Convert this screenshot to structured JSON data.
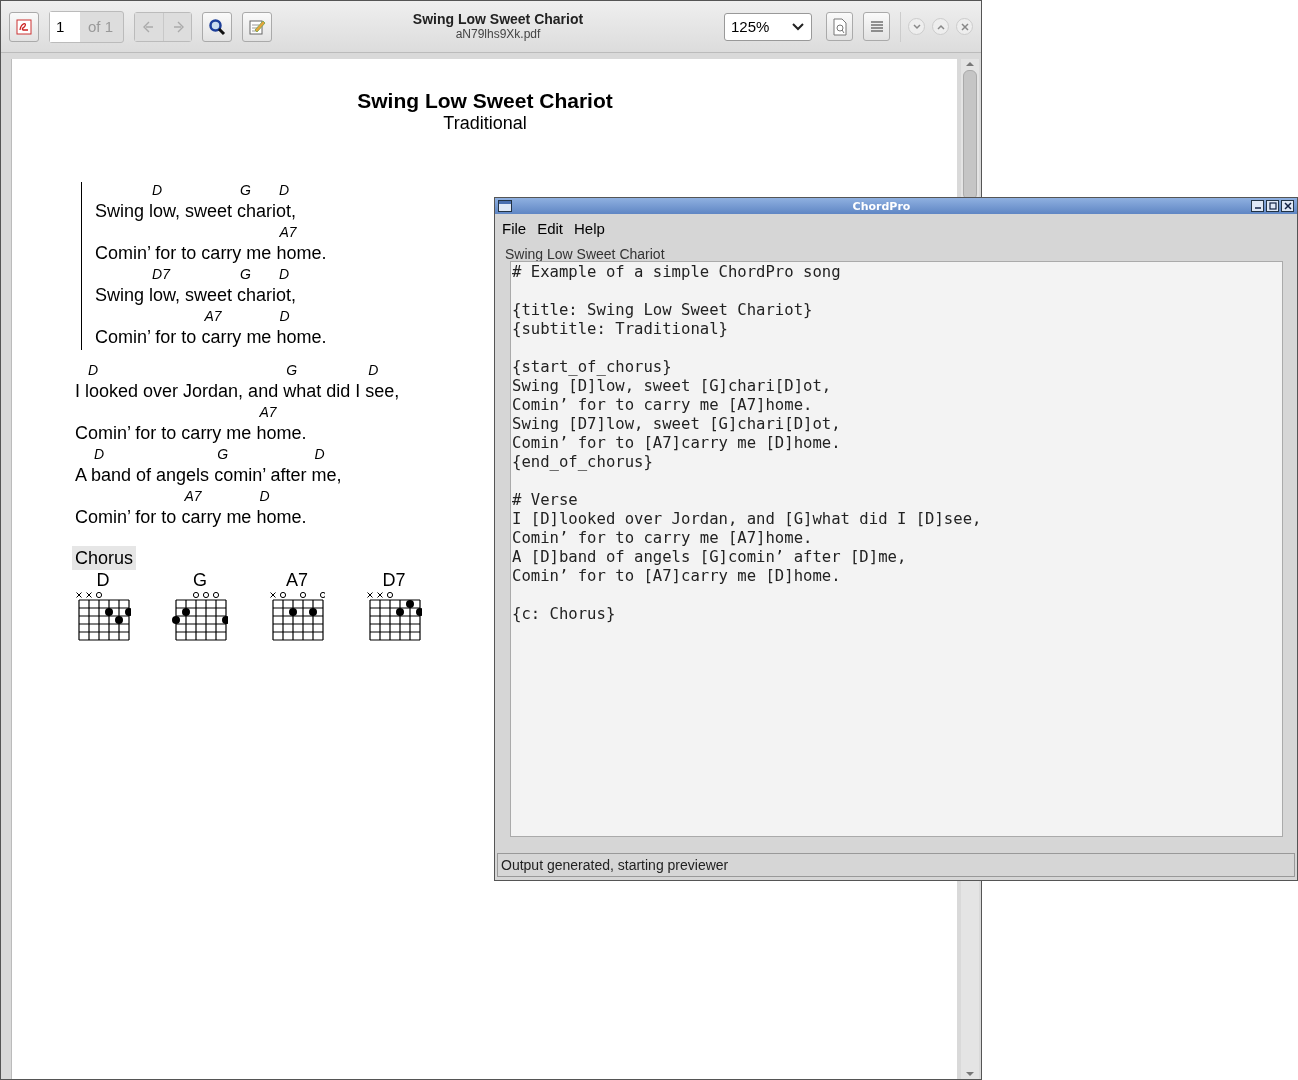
{
  "viewer": {
    "title": "Swing Low Sweet Chariot",
    "filename": "aN79lhs9Xk.pdf",
    "page": "1",
    "page_count": "of 1",
    "nav_disabled": true,
    "zoom": "125%"
  },
  "document": {
    "title": "Swing Low Sweet Chariot",
    "subtitle": "Traditional",
    "sections": [
      {
        "kind": "chorus",
        "lines": [
          [
            {
              "text": "Swing "
            },
            {
              "chord": "D",
              "text": "low, sweet "
            },
            {
              "chord": "G",
              "text": "chari"
            },
            {
              "chord": "D",
              "text": "ot,"
            }
          ],
          [
            {
              "text": "Comin’ for to carry me "
            },
            {
              "chord": "A7",
              "text": "home."
            }
          ],
          [
            {
              "text": "Swing "
            },
            {
              "chord": "D7",
              "text": "low, sweet "
            },
            {
              "chord": "G",
              "text": "chari"
            },
            {
              "chord": "D",
              "text": "ot,"
            }
          ],
          [
            {
              "text": "Comin’ for to "
            },
            {
              "chord": "A7",
              "text": "carry me "
            },
            {
              "chord": "D",
              "text": "home."
            }
          ]
        ]
      },
      {
        "kind": "verse",
        "lines": [
          [
            {
              "text": "I "
            },
            {
              "chord": "D",
              "text": "looked over Jordan, and "
            },
            {
              "chord": "G",
              "text": "what did I "
            },
            {
              "chord": "D",
              "text": "see,"
            }
          ],
          [
            {
              "text": "Comin’ for to carry me "
            },
            {
              "chord": "A7",
              "text": "home."
            }
          ],
          [
            {
              "text": "A "
            },
            {
              "chord": "D",
              "text": "band of angels "
            },
            {
              "chord": "G",
              "text": "comin’ after "
            },
            {
              "chord": "D",
              "text": "me,"
            }
          ],
          [
            {
              "text": "Comin’ for to "
            },
            {
              "chord": "A7",
              "text": "carry me "
            },
            {
              "chord": "D",
              "text": "home."
            }
          ]
        ]
      },
      {
        "kind": "comment",
        "text": "Chorus"
      }
    ],
    "chord_diagrams": [
      {
        "name": "D",
        "strings": [
          {
            "kind": "muted"
          },
          {
            "kind": "muted"
          },
          {
            "kind": "open"
          },
          {
            "kind": "fret2"
          },
          {
            "kind": "fret3"
          },
          {
            "kind": "fret2"
          }
        ]
      },
      {
        "name": "G",
        "strings": [
          {
            "kind": "fret3"
          },
          {
            "kind": "fret2"
          },
          {
            "kind": "open"
          },
          {
            "kind": "open"
          },
          {
            "kind": "open"
          },
          {
            "kind": "fret3"
          }
        ]
      },
      {
        "name": "A7",
        "strings": [
          {
            "kind": "muted"
          },
          {
            "kind": "open"
          },
          {
            "kind": "fret2"
          },
          {
            "kind": "open"
          },
          {
            "kind": "fret2"
          },
          {
            "kind": "open"
          }
        ]
      },
      {
        "name": "D7",
        "strings": [
          {
            "kind": "muted"
          },
          {
            "kind": "muted"
          },
          {
            "kind": "open"
          },
          {
            "kind": "fret2"
          },
          {
            "kind": "fret1"
          },
          {
            "kind": "fret2"
          }
        ]
      }
    ]
  },
  "editor": {
    "title": "ChordPro",
    "menu": [
      "File",
      "Edit",
      "Help"
    ],
    "label": "Swing Low Sweet Chariot",
    "blocks": [
      [
        "# Example of a simple ChordPro song"
      ],
      [
        "{title: Swing Low Sweet Chariot}",
        "{subtitle: Traditional}"
      ],
      [
        "{start_of_chorus}",
        "Swing [D]low, sweet [G]chari[D]ot,",
        "Comin’ for to carry me [A7]home.",
        "Swing [D7]low, sweet [G]chari[D]ot,",
        "Comin’ for to [A7]carry me [D]home.",
        "{end_of_chorus}"
      ],
      [
        "# Verse",
        "I [D]looked over Jordan, and [G]what did I [D]see,",
        "Comin’ for to carry me [A7]home.",
        "A [D]band of angels [G]comin’ after [D]me,",
        "Comin’ for to [A7]carry me [D]home."
      ],
      [
        "{c: Chorus}"
      ]
    ],
    "status": "Output generated, starting previewer"
  }
}
